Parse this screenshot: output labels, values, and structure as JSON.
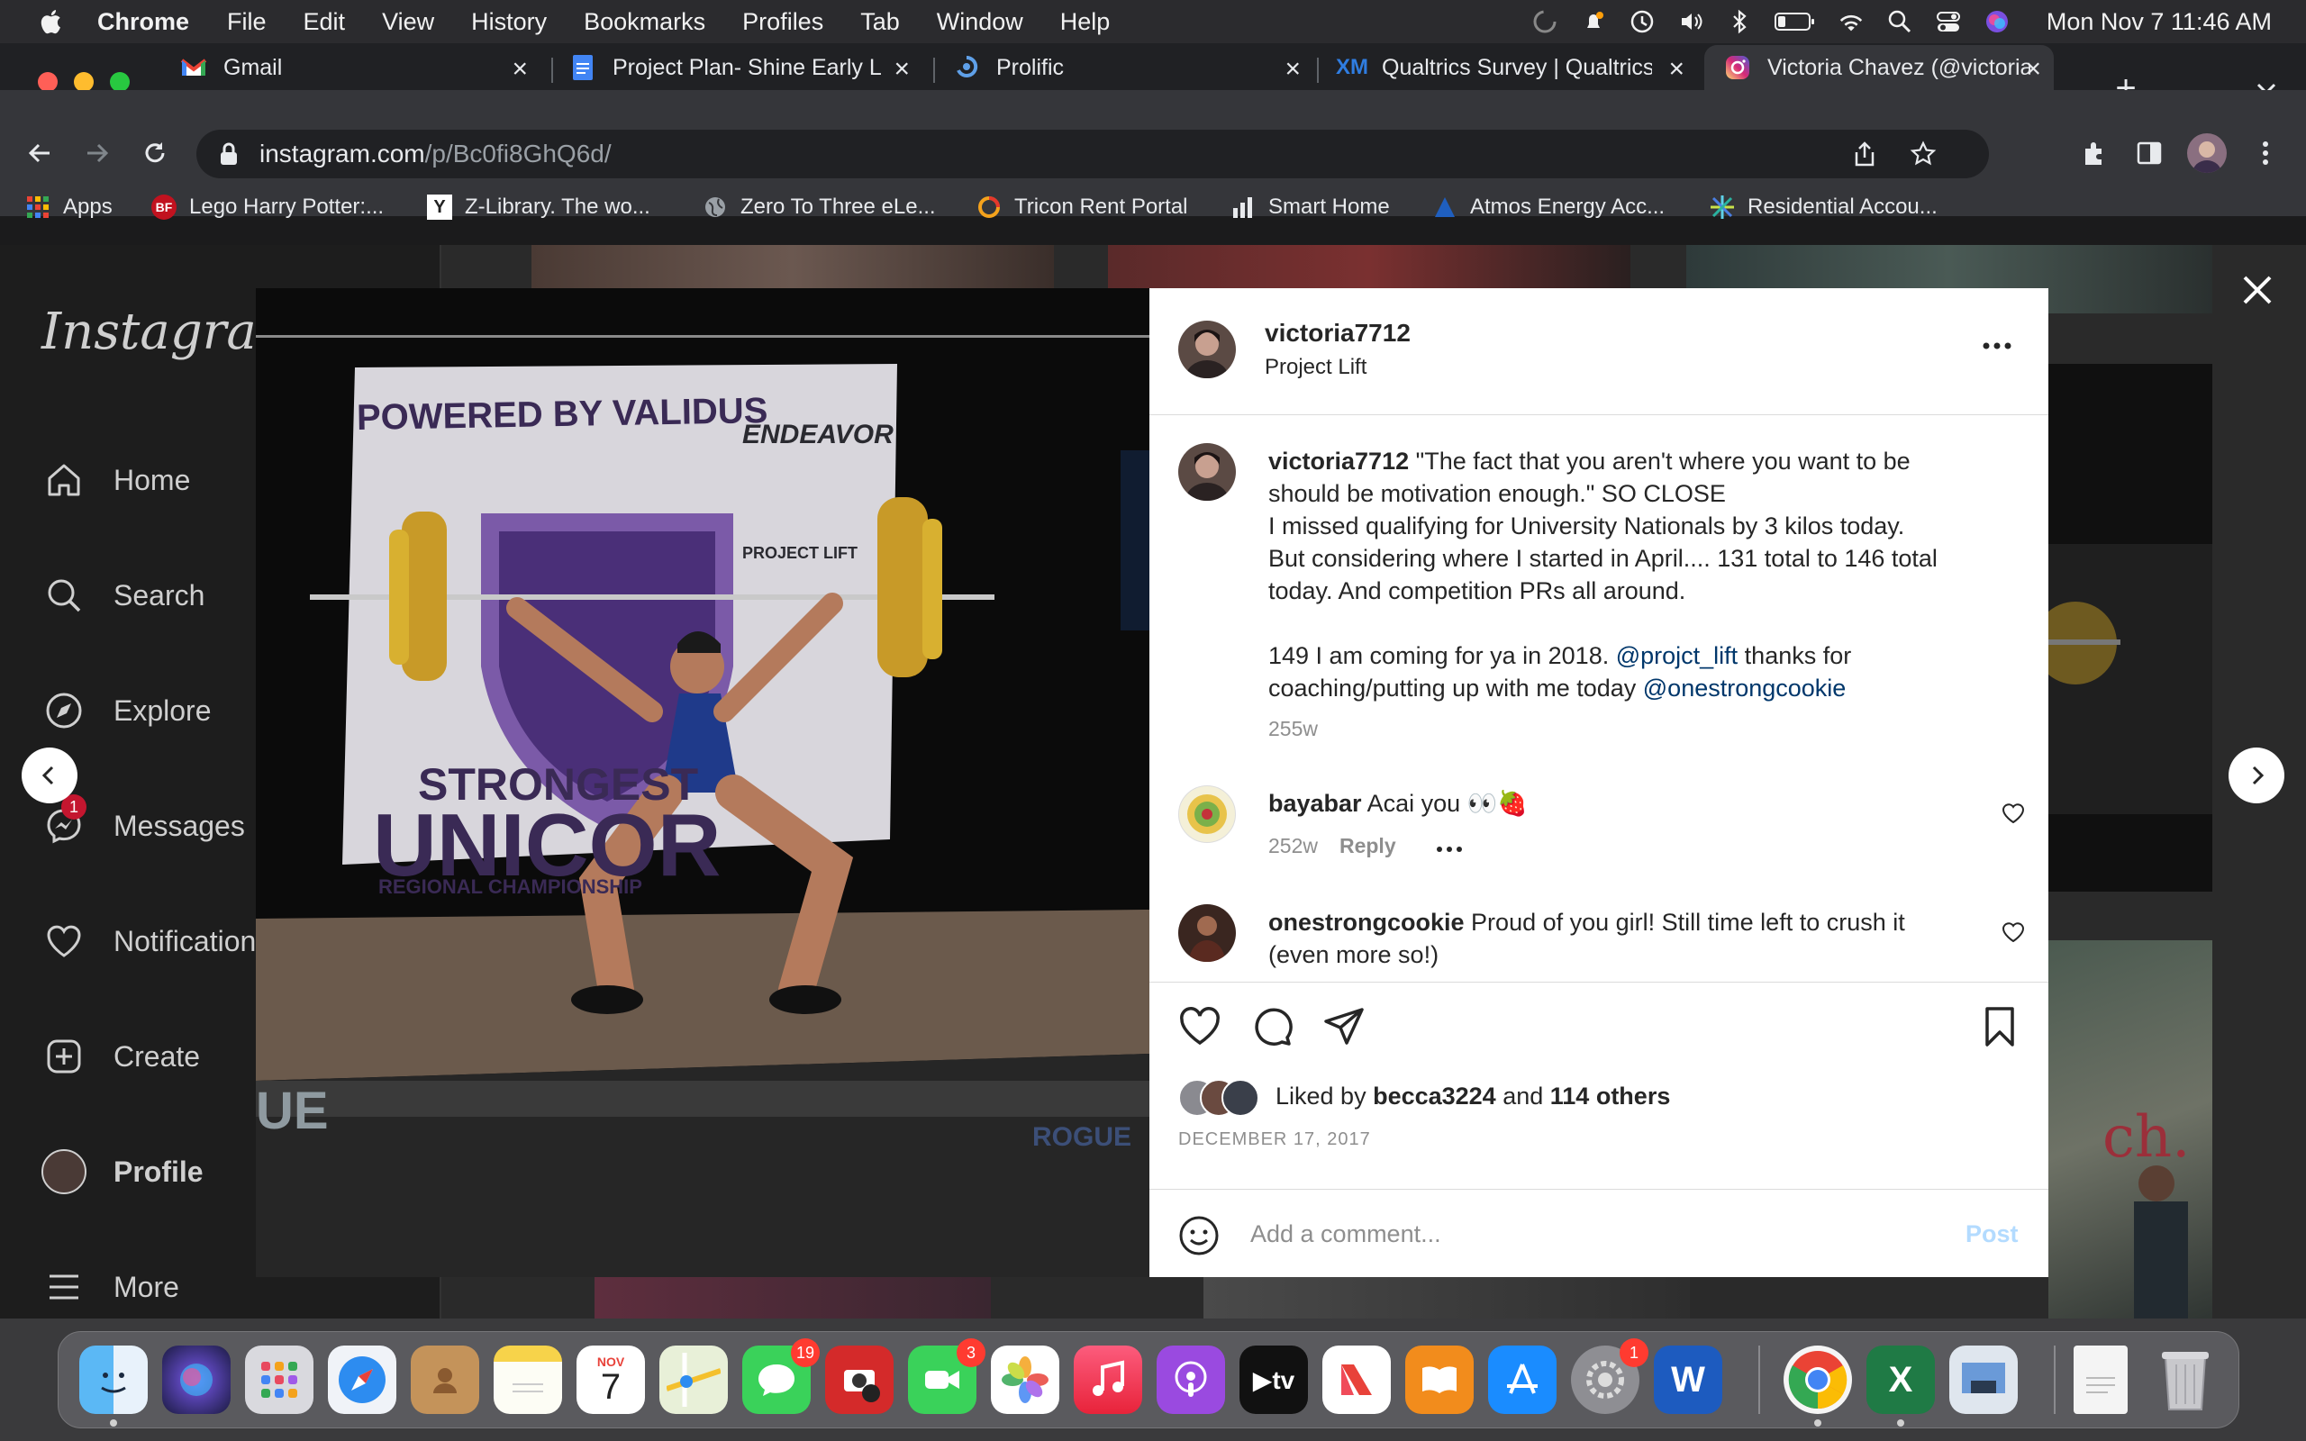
{
  "menubar": {
    "app": "Chrome",
    "items": [
      "File",
      "Edit",
      "View",
      "History",
      "Bookmarks",
      "Profiles",
      "Tab",
      "Window",
      "Help"
    ],
    "clock": "Mon Nov 7  11:46 AM"
  },
  "tabs": [
    {
      "title": "Gmail",
      "icon": "gmail-icon"
    },
    {
      "title": "Project Plan- Shine Early L",
      "icon": "docs-icon"
    },
    {
      "title": "Prolific",
      "icon": "prolific-icon"
    },
    {
      "title": "Qualtrics Survey | Qualtrics",
      "icon": "qualtrics-icon"
    },
    {
      "title": "Victoria Chavez (@victoria",
      "icon": "instagram-icon",
      "active": true
    }
  ],
  "toolbar": {
    "url_host": "instagram.com",
    "url_path": "/p/Bc0fi8GhQ6d/"
  },
  "bookmarks": [
    {
      "label": "Apps",
      "icon": "apps-grid-icon"
    },
    {
      "label": "Lego Harry Potter:...",
      "icon": "bf-icon"
    },
    {
      "label": "Z-Library. The wo...",
      "icon": "zlibrary-icon"
    },
    {
      "label": "Zero To Three eLe...",
      "icon": "globe-icon"
    },
    {
      "label": "Tricon Rent Portal",
      "icon": "tricon-icon"
    },
    {
      "label": "Smart Home",
      "icon": "bars-icon"
    },
    {
      "label": "Atmos Energy Acc...",
      "icon": "atmos-icon"
    },
    {
      "label": "Residential Accou...",
      "icon": "starburst-icon"
    }
  ],
  "instagram": {
    "logo": "Instagram",
    "nav": [
      {
        "label": "Home",
        "icon": "home-icon"
      },
      {
        "label": "Search",
        "icon": "search-icon"
      },
      {
        "label": "Explore",
        "icon": "compass-icon"
      },
      {
        "label": "Messages",
        "icon": "messenger-icon",
        "badge": "1"
      },
      {
        "label": "Notifications",
        "icon": "heart-icon"
      },
      {
        "label": "Create",
        "icon": "plus-square-icon"
      },
      {
        "label": "Profile",
        "icon": "profile-avatar"
      },
      {
        "label": "More",
        "icon": "hamburger-icon"
      }
    ]
  },
  "post": {
    "author": "victoria7712",
    "location": "Project Lift",
    "caption_lines": [
      "\"The fact that you aren't where you want to be",
      "should be motivation enough.\" SO CLOSE",
      "I missed qualifying for University Nationals by 3 kilos today.",
      "But considering where I started in April.... 131 total to 146 total",
      "today. And competition PRs all around."
    ],
    "caption_p2_a": "149 I am coming for ya in 2018. ",
    "caption_mention1": "@projct_lift",
    "caption_p2_b": " thanks for",
    "caption_p2_c": "coaching/putting up with me today ",
    "caption_mention2": "@onestrongcookie",
    "caption_age": "255w",
    "comments": [
      {
        "user": "bayabar",
        "text": "Acai you 👀🍓",
        "age": "252w",
        "reply": "Reply"
      },
      {
        "user": "onestrongcookie",
        "text": "Proud of you girl! Still time left to crush it",
        "text2": "(even more so!)"
      }
    ],
    "likes_prefix": "Liked by ",
    "likes_user": "becca3224",
    "likes_mid": " and ",
    "likes_others": "114 others",
    "date": "DECEMBER 17, 2017",
    "comment_placeholder": "Add a comment...",
    "post_button": "Post"
  },
  "photo_text": {
    "banner_top": "POWERED BY VALIDUS",
    "endeavor": "ENDEAVOR",
    "project_lift": "PROJECT LIFT",
    "strongest": "STRONGEST",
    "unicorn": "UNICOR",
    "regional": "REGIONAL CHAMPIONSHIP",
    "rogue": "ROGUE",
    "ue": "UE"
  },
  "dock": {
    "calendar_month": "NOV",
    "calendar_day": "7",
    "badges": {
      "messages": "19",
      "photobooth": "",
      "facetime": "3",
      "settings": "1"
    }
  }
}
